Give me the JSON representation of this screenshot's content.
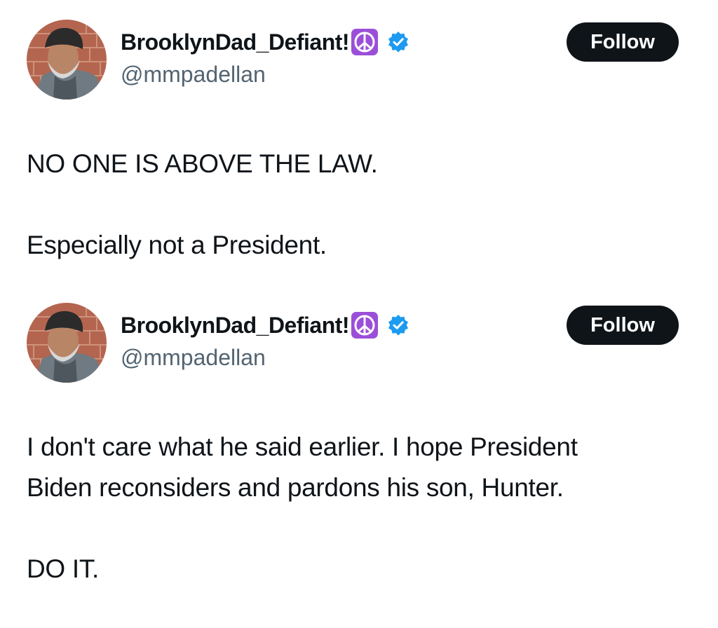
{
  "tweets": [
    {
      "author": {
        "display_name": "BrooklynDad_Defiant!",
        "emoji_icon": "peace-symbol",
        "verified_icon": "verified-badge",
        "handle": "@mmpadellan"
      },
      "follow_label": "Follow",
      "paragraphs": [
        "NO ONE IS ABOVE THE LAW.",
        "Especially not a President."
      ]
    },
    {
      "author": {
        "display_name": "BrooklynDad_Defiant!",
        "emoji_icon": "peace-symbol",
        "verified_icon": "verified-badge",
        "handle": "@mmpadellan"
      },
      "follow_label": "Follow",
      "paragraphs": [
        "I don't care what he said earlier. I hope President",
        "Biden reconsiders and pardons his son, Hunter.",
        "DO IT."
      ]
    }
  ],
  "colors": {
    "text": "#0f1419",
    "handle": "#536471",
    "follow_bg": "#0f1419",
    "follow_text": "#ffffff",
    "verified": "#1d9bf0",
    "peace_bg": "#9b4fd9"
  }
}
